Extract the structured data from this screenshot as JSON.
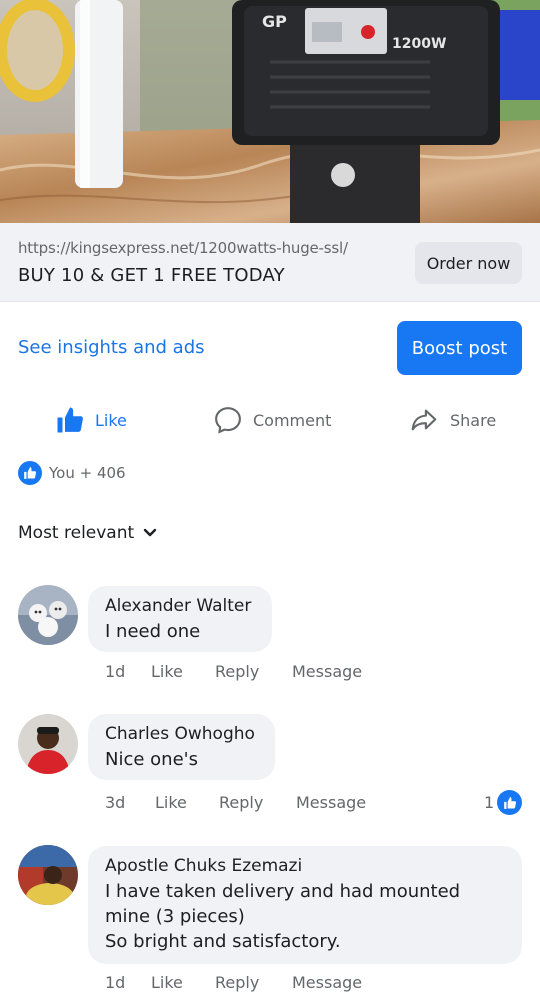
{
  "ad_image": {
    "device_brand": "GP",
    "device_wattage": "1200W"
  },
  "link_preview": {
    "url": "https://kingsexpress.net/1200watts-huge-ssl/",
    "headline": "BUY 10 & GET 1 FREE TODAY",
    "cta_label": "Order now"
  },
  "post_tools": {
    "insights_label": "See insights and ads",
    "boost_label": "Boost post"
  },
  "actions": {
    "like": "Like",
    "comment": "Comment",
    "share": "Share"
  },
  "reactions": {
    "summary": "You + 406"
  },
  "comments_sort": {
    "label": "Most relevant"
  },
  "comments": [
    {
      "author": "Alexander Walter",
      "text_lines": [
        "I need one"
      ],
      "time": "1d",
      "like": "Like",
      "reply": "Reply",
      "message": "Message",
      "reaction_count": ""
    },
    {
      "author": "Charles Owhogho",
      "text_lines": [
        "Nice one's"
      ],
      "time": "3d",
      "like": "Like",
      "reply": "Reply",
      "message": "Message",
      "reaction_count": "1"
    },
    {
      "author": "Apostle Chuks Ezemazi",
      "text_lines": [
        "I have taken delivery and had mounted",
        "mine (3 pieces)",
        "So bright and satisfactory."
      ],
      "time": "1d",
      "like": "Like",
      "reply": "Reply",
      "message": "Message",
      "reaction_count": ""
    }
  ],
  "colors": {
    "accent": "#1877f2",
    "link_blue": "#1b74e4",
    "bubble_bg": "#f0f2f5",
    "muted_text": "#65676b"
  }
}
